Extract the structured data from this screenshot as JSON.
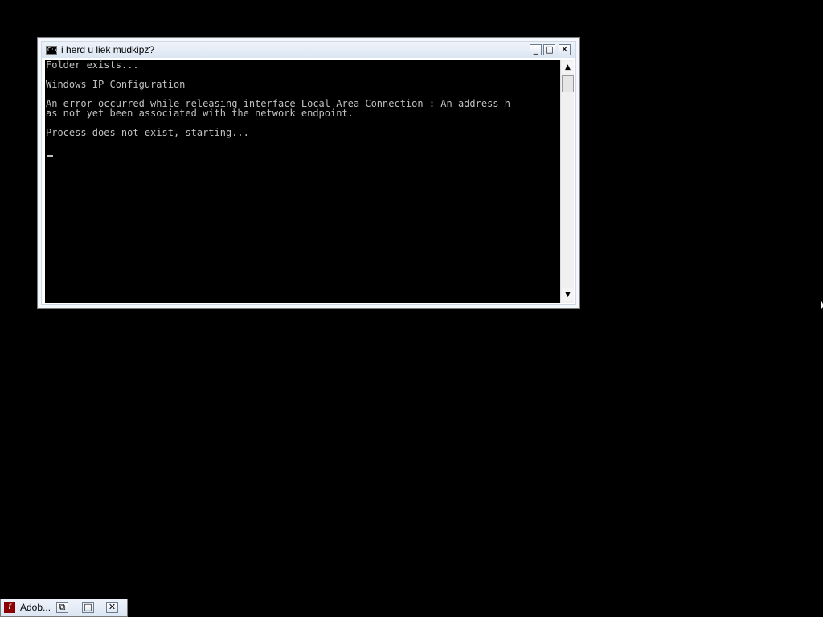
{
  "window": {
    "title": "i herd u liek mudkipz?",
    "icon_label": "C:\\",
    "controls": {
      "minimize": "_",
      "maximize": "□",
      "close": "✕"
    },
    "console_lines": [
      "Folder exists...",
      "",
      "Windows IP Configuration",
      "",
      "An error occurred while releasing interface Local Area Connection : An address h",
      "as not yet been associated with the network endpoint.",
      "",
      "Process does not exist, starting..."
    ]
  },
  "scrollbar": {
    "up_arrow": "▲",
    "down_arrow": "▼"
  },
  "taskbar_window": {
    "label": "Adob...",
    "icon_label": "f",
    "controls": {
      "restore": "⧉",
      "maximize": "□",
      "close": "✕"
    }
  },
  "colors": {
    "console_bg": "#000000",
    "console_fg": "#c0c0c0",
    "desktop": "#000000"
  }
}
